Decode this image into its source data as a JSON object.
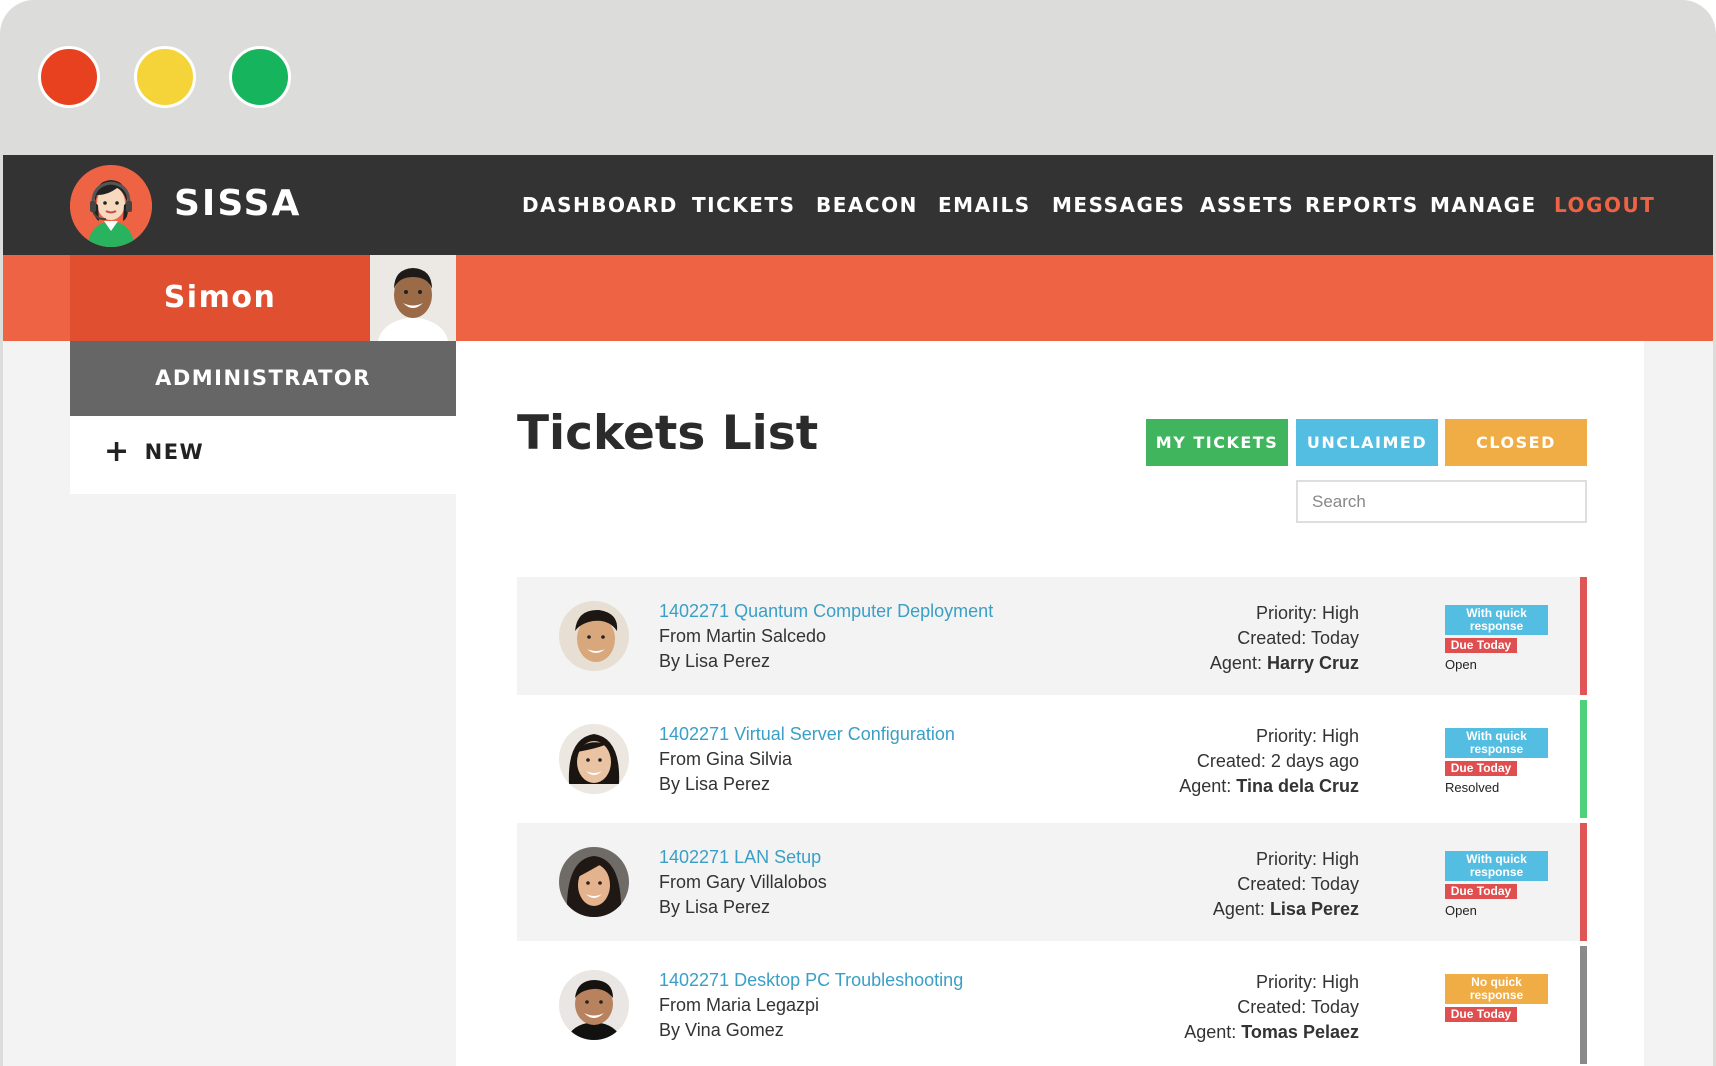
{
  "window": {
    "controls": [
      "close",
      "minimize",
      "maximize"
    ]
  },
  "navbar": {
    "brand": "SISSA",
    "links": [
      "DASHBOARD",
      "TICKETS",
      "BEACON",
      "EMAILS",
      "MESSAGES",
      "ASSETS",
      "REPORTS",
      "MANAGE"
    ],
    "logout": "LOGOUT"
  },
  "user": {
    "name": "Simon",
    "role": "ADMINISTRATOR"
  },
  "sidebar": {
    "new_label": "NEW"
  },
  "page": {
    "title": "Tickets List",
    "tabs": {
      "my": "MY TICKETS",
      "unclaimed": "UNCLAIMED",
      "closed": "CLOSED"
    },
    "search_placeholder": "Search"
  },
  "tickets": [
    {
      "subject": "1402271 Quantum Computer Deployment",
      "from": "From Martin Salcedo",
      "by": "By Lisa Perez",
      "priority": "Priority: High",
      "created": "Created: Today",
      "agent_label": "Agent:",
      "agent": "Harry Cruz",
      "response_badge": "With quick response",
      "due": "Due Today",
      "status": "Open",
      "stripe_color": "#e05555"
    },
    {
      "subject": "1402271 Virtual Server Configuration",
      "from": "From Gina Silvia",
      "by": "By Lisa Perez",
      "priority": "Priority: High",
      "created": "Created: 2 days ago",
      "agent_label": "Agent:",
      "agent": "Tina dela Cruz",
      "response_badge": "With quick response",
      "due": "Due Today",
      "status": "Resolved",
      "stripe_color": "#4fd07d"
    },
    {
      "subject": "1402271 LAN Setup",
      "from": "From Gary Villalobos",
      "by": "By Lisa Perez",
      "priority": "Priority: High",
      "created": "Created: Today",
      "agent_label": "Agent:",
      "agent": "Lisa Perez",
      "response_badge": "With quick response",
      "due": "Due Today",
      "status": "Open",
      "stripe_color": "#e05555"
    },
    {
      "subject": "1402271 Desktop PC Troubleshooting",
      "from": "From Maria Legazpi",
      "by": "By Vina Gomez",
      "priority": "Priority: High",
      "created": "Created: Today",
      "agent_label": "Agent:",
      "agent": "Tomas Pelaez",
      "response_badge": "No quick response",
      "due": "Due Today",
      "status": "",
      "stripe_color": "#8a8a8a"
    }
  ],
  "colors": {
    "accent": "#ef6345",
    "nav_bg": "#333333",
    "link": "#3a9fc7",
    "my_tickets": "#41b55e",
    "unclaimed": "#53bee2",
    "closed": "#f0ac45"
  }
}
